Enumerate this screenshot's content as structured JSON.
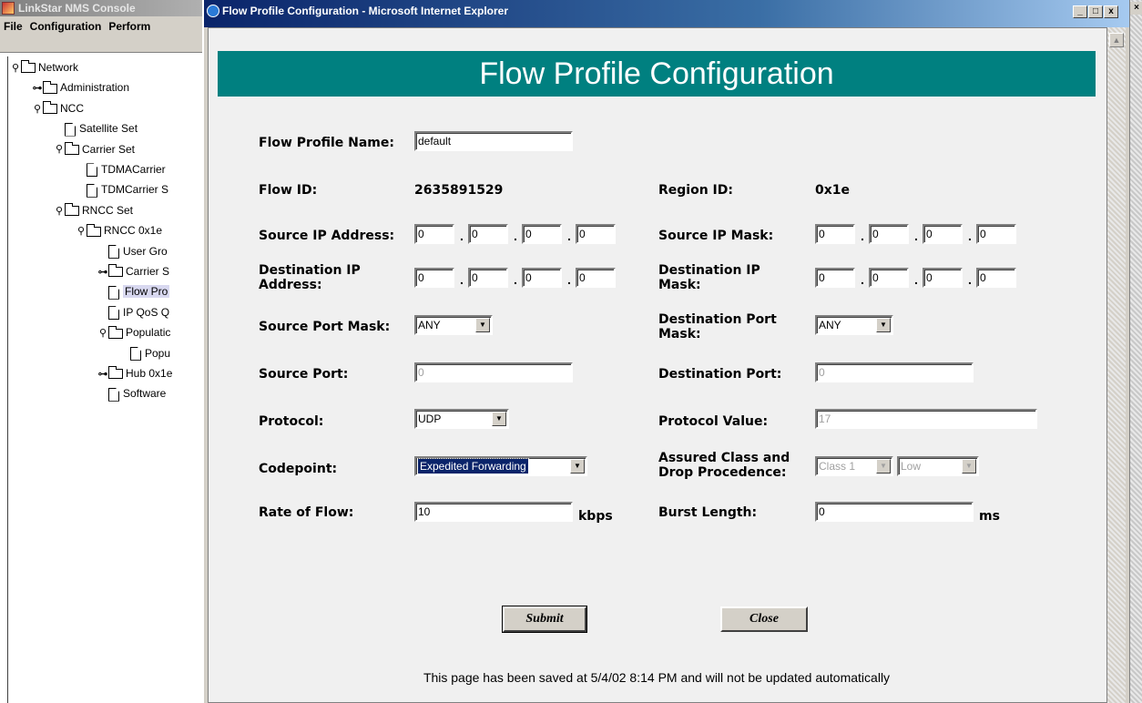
{
  "console": {
    "title": "LinkStar NMS Console",
    "menu": [
      "File",
      "Configuration",
      "Perform"
    ],
    "tree": [
      {
        "label": "Network",
        "type": "folder",
        "toggle": "⚲",
        "indent": 0
      },
      {
        "label": "Administration",
        "type": "folder",
        "toggle": "⊶",
        "indent": 1
      },
      {
        "label": "NCC",
        "type": "folder",
        "toggle": "⚲",
        "indent": 1
      },
      {
        "label": "Satellite Set",
        "type": "doc",
        "toggle": "",
        "indent": 2
      },
      {
        "label": "Carrier Set",
        "type": "folder",
        "toggle": "⚲",
        "indent": 2
      },
      {
        "label": "TDMACarrier",
        "type": "doc",
        "toggle": "",
        "indent": 3
      },
      {
        "label": "TDMCarrier S",
        "type": "doc",
        "toggle": "",
        "indent": 3
      },
      {
        "label": "RNCC Set",
        "type": "folder",
        "toggle": "⚲",
        "indent": 2
      },
      {
        "label": "RNCC 0x1e",
        "type": "folder",
        "toggle": "⚲",
        "indent": 3
      },
      {
        "label": "User Gro",
        "type": "doc",
        "toggle": "",
        "indent": 4
      },
      {
        "label": "Carrier S",
        "type": "folder",
        "toggle": "⊶",
        "indent": 4
      },
      {
        "label": "Flow Pro",
        "type": "doc",
        "toggle": "",
        "indent": 4,
        "selected": true
      },
      {
        "label": "IP QoS Q",
        "type": "doc",
        "toggle": "",
        "indent": 4
      },
      {
        "label": "Populatic",
        "type": "folder",
        "toggle": "⚲",
        "indent": 4
      },
      {
        "label": "Popu",
        "type": "doc",
        "toggle": "",
        "indent": 5
      },
      {
        "label": "Hub 0x1e",
        "type": "folder",
        "toggle": "⊶",
        "indent": 4
      },
      {
        "label": "Software",
        "type": "doc",
        "toggle": "",
        "indent": 4
      }
    ]
  },
  "ie": {
    "title": "Flow Profile Configuration - Microsoft Internet Explorer",
    "min": "_",
    "max": "□",
    "close": "x"
  },
  "form": {
    "heading": "Flow Profile Configuration",
    "profile_name_label": "Flow Profile Name:",
    "profile_name_value": "default",
    "flow_id_label": "Flow ID:",
    "flow_id_value": "2635891529",
    "region_id_label": "Region ID:",
    "region_id_value": "0x1e",
    "src_ip_label": "Source IP Address:",
    "src_ip": [
      "0",
      "0",
      "0",
      "0"
    ],
    "src_mask_label": "Source IP Mask:",
    "src_mask": [
      "0",
      "0",
      "0",
      "0"
    ],
    "dst_ip_label": "Destination IP Address:",
    "dst_ip": [
      "0",
      "0",
      "0",
      "0"
    ],
    "dst_mask_label": "Destination IP Mask:",
    "dst_mask": [
      "0",
      "0",
      "0",
      "0"
    ],
    "src_port_mask_label": "Source Port Mask:",
    "src_port_mask_value": "ANY",
    "dst_port_mask_label": "Destination Port Mask:",
    "dst_port_mask_value": "ANY",
    "src_port_label": "Source Port:",
    "src_port_value": "0",
    "dst_port_label": "Destination Port:",
    "dst_port_value": "0",
    "protocol_label": "Protocol:",
    "protocol_value": "UDP",
    "protocol_num_label": "Protocol Value:",
    "protocol_num_value": "17",
    "codepoint_label": "Codepoint:",
    "codepoint_value": "Expedited Forwarding",
    "assured_label": "Assured Class and Drop Procedence:",
    "assured_class_value": "Class 1",
    "drop_value": "Low",
    "rate_label": "Rate of Flow:",
    "rate_value": "10",
    "rate_unit": "kbps",
    "burst_label": "Burst Length:",
    "burst_value": "0",
    "burst_unit": "ms",
    "submit_label": "Submit",
    "close_label": "Close",
    "footer": "This page has been saved at 5/4/02 8:14 PM and will not be updated automatically"
  }
}
